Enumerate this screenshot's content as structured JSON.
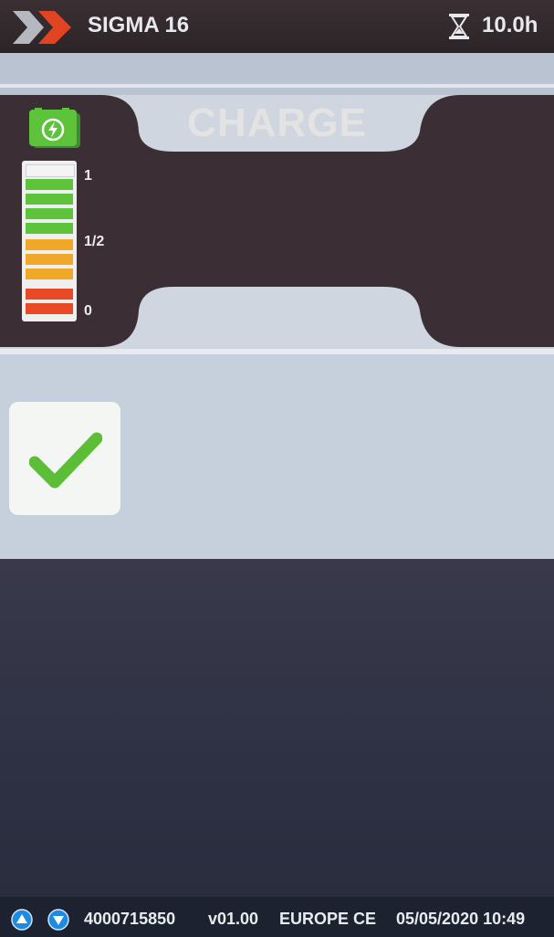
{
  "header": {
    "app_title": "SIGMA 16",
    "timer_value": "10.0h"
  },
  "main": {
    "mode_label": "CHARGE",
    "gauge": {
      "label_full": "1",
      "label_half": "1/2",
      "label_empty": "0",
      "level": 0.85
    },
    "status": "ok"
  },
  "statusbar": {
    "serial": "4000715850",
    "version": "v01.00",
    "region": "EUROPE CE",
    "datetime": "05/05/2020 10:49"
  },
  "colors": {
    "accent_green": "#5cc33b",
    "accent_red": "#e84a25",
    "accent_orange": "#f0a828",
    "nav_blue": "#1e8be0"
  }
}
